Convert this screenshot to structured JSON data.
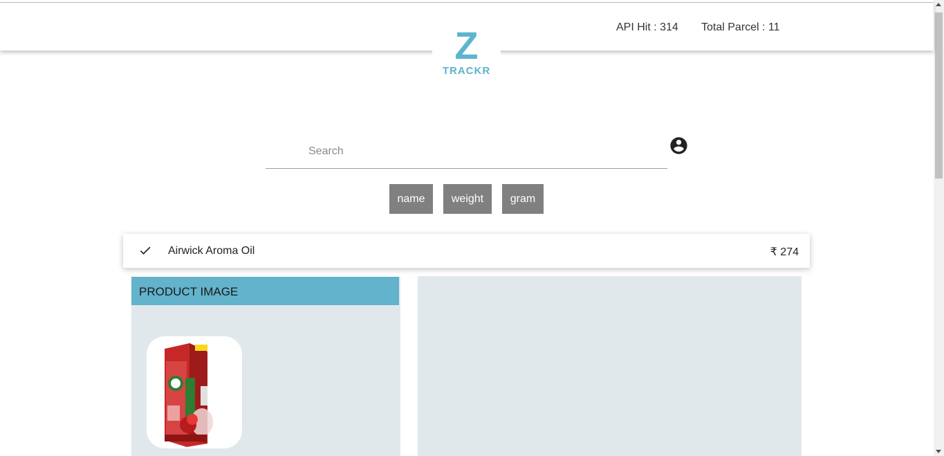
{
  "header": {
    "api_hit": "API Hit : 314",
    "total_parcel": "Total Parcel : 11"
  },
  "logo": {
    "letter": "Z",
    "text": "TRACKR"
  },
  "search": {
    "placeholder": "Search",
    "value": ""
  },
  "icons": {
    "account": "account-circle-icon",
    "check": "check-icon"
  },
  "filters": [
    {
      "label": "name"
    },
    {
      "label": "weight"
    },
    {
      "label": "gram"
    }
  ],
  "product": {
    "name": "Airwick Aroma Oil",
    "price": "₹ 274",
    "image_panel_title": "PRODUCT IMAGE"
  },
  "colors": {
    "brand": "#5db4cd",
    "panel_header": "#62b3cb",
    "panel_bg": "#e1e8eb",
    "filter_button": "#808080"
  }
}
